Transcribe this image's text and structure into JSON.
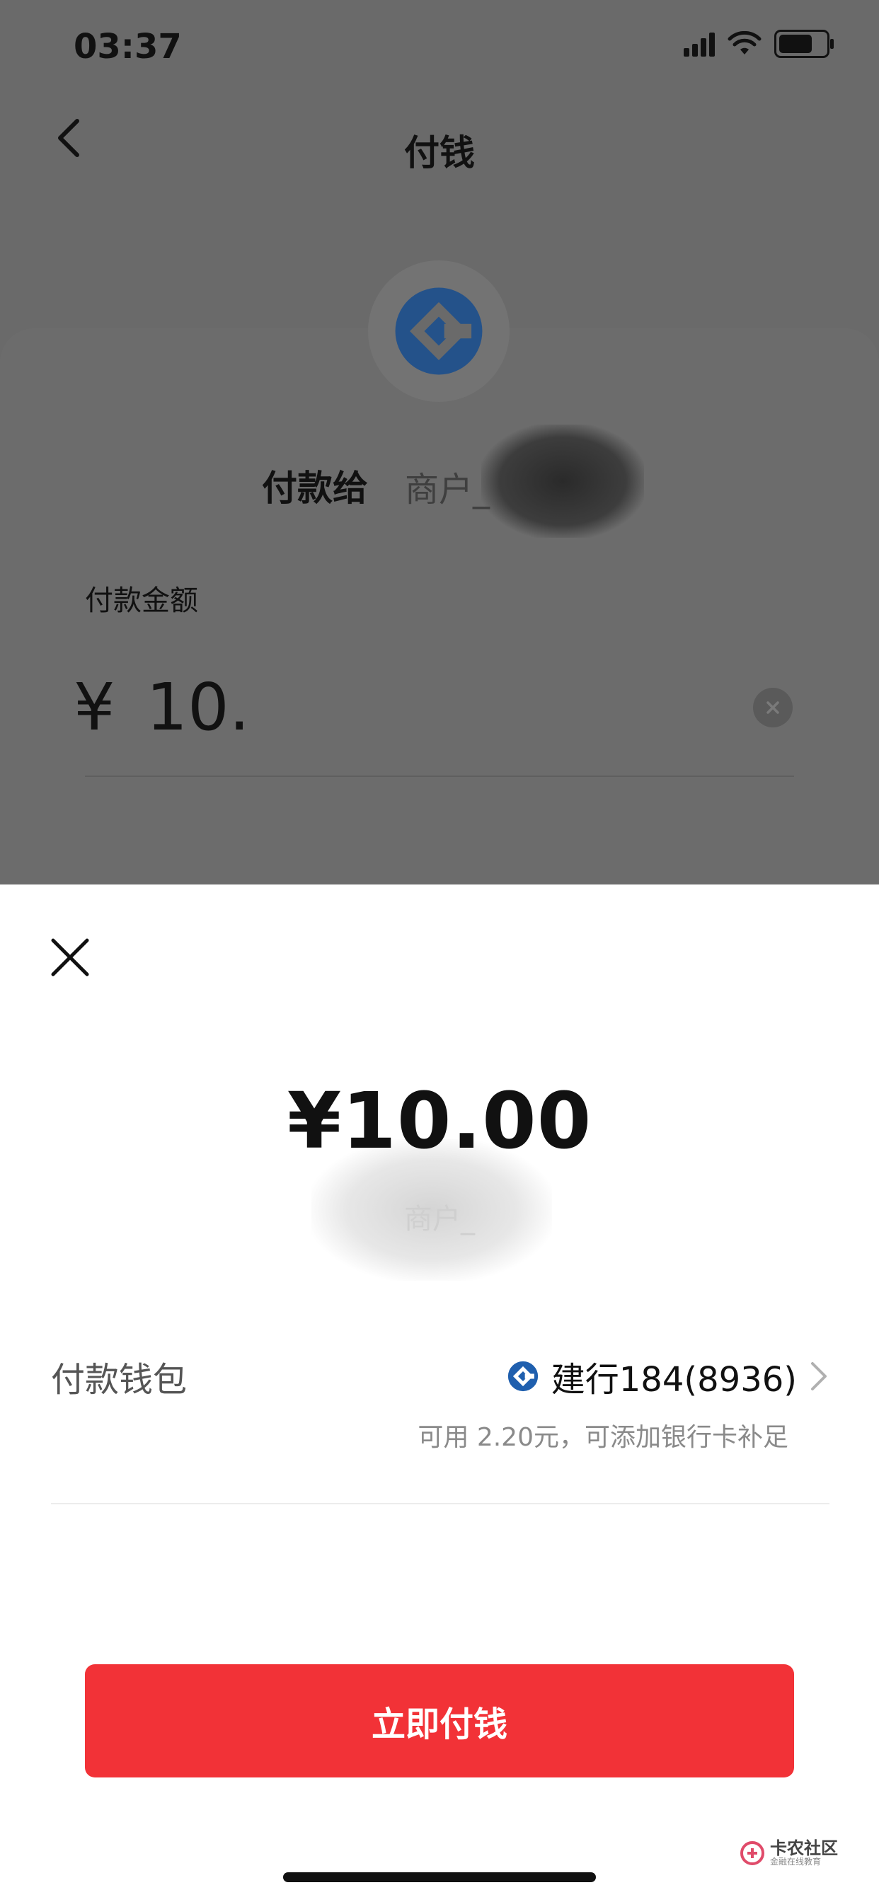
{
  "status_bar": {
    "time": "03:37"
  },
  "header": {
    "title": "付钱"
  },
  "merchant": {
    "pay_to_label": "付款给",
    "name": "商户_"
  },
  "amount_entry": {
    "label": "付款金额",
    "currency": "¥",
    "value": "10."
  },
  "sheet": {
    "amount_display": "¥10.00",
    "merchant_name": "商户_",
    "wallet_label": "付款钱包",
    "wallet_value": "建行184(8936)",
    "wallet_hint": "可用 2.20元，可添加银行卡补足",
    "pay_button_label": "立即付钱"
  },
  "watermark": {
    "title": "卡农社区",
    "subtitle": "金融在线教育"
  },
  "colors": {
    "accent_red": "#f23237",
    "bank_blue": "#1f5fae"
  }
}
